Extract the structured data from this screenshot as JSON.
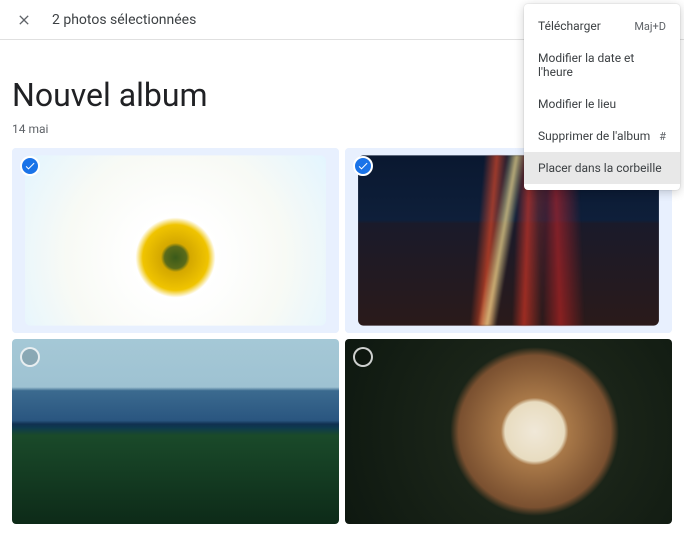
{
  "topbar": {
    "selection_text": "2 photos sélectionnées"
  },
  "album": {
    "title": "Nouvel album",
    "date": "14 mai"
  },
  "menu": {
    "items": [
      {
        "label": "Télécharger",
        "shortcut": "Maj+D"
      },
      {
        "label": "Modifier la date et l'heure",
        "shortcut": ""
      },
      {
        "label": "Modifier le lieu",
        "shortcut": ""
      },
      {
        "label": "Supprimer de l'album",
        "shortcut": "#"
      },
      {
        "label": "Placer dans la corbeille",
        "shortcut": ""
      }
    ]
  }
}
